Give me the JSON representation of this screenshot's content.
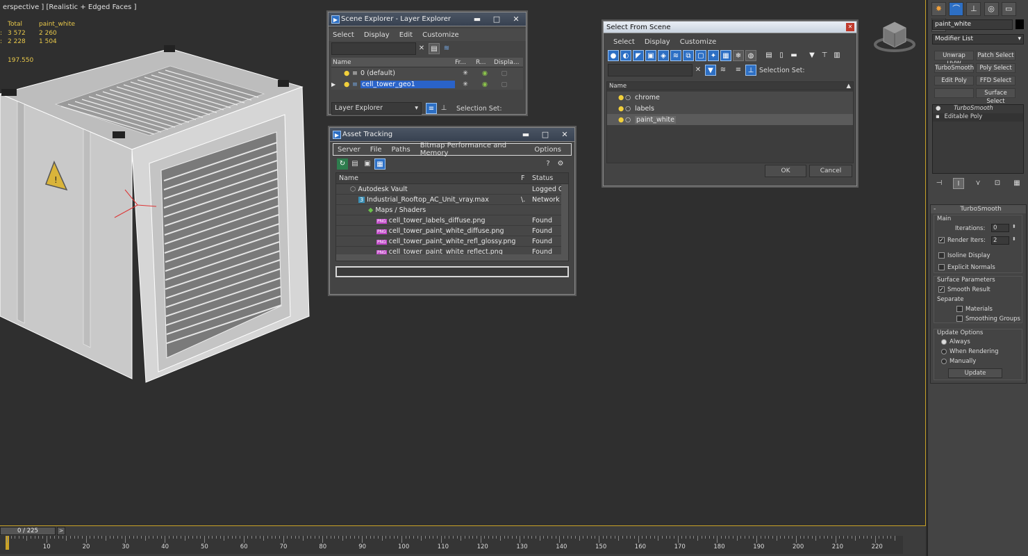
{
  "viewport": {
    "label": "erspective ] [Realistic + Edged Faces ]",
    "stats_header_total": "Total",
    "stats_header_sel": "paint_white",
    "row1_total": "3 572",
    "row1_sel": "2 260",
    "row2_total": "2 228",
    "row2_sel": "1 504",
    "fps": "197.550"
  },
  "layer_explorer": {
    "title": "Scene Explorer - Layer Explorer",
    "menu": [
      "Select",
      "Display",
      "Edit",
      "Customize"
    ],
    "columns": [
      "Name",
      "Fr...",
      "R...",
      "Displa..."
    ],
    "rows": [
      "0 (default)",
      "cell_tower_geo1"
    ],
    "footer_dropdown": "Layer Explorer",
    "selection_set": "Selection Set:"
  },
  "asset_tracking": {
    "title": "Asset Tracking",
    "menu": [
      "Server",
      "File",
      "Paths",
      "Bitmap Performance and Memory",
      "Options"
    ],
    "columns": [
      "Name",
      "F",
      "Status"
    ],
    "rows": [
      {
        "name": "Autodesk Vault",
        "f": "",
        "status": "Logged O"
      },
      {
        "name": "Industrial_Rooftop_AC_Unit_vray.max",
        "f": "\\.",
        "status": "Network"
      },
      {
        "name": "Maps / Shaders",
        "f": "",
        "status": ""
      },
      {
        "name": "cell_tower_labels_diffuse.png",
        "f": "",
        "status": "Found"
      },
      {
        "name": "cell_tower_paint_white_diffuse.png",
        "f": "",
        "status": "Found"
      },
      {
        "name": "cell_tower_paint_white_refl_glossy.png",
        "f": "",
        "status": "Found"
      },
      {
        "name": "cell_tower_paint_white_reflect.png",
        "f": "",
        "status": "Found"
      }
    ]
  },
  "select_from_scene": {
    "title": "Select From Scene",
    "menu": [
      "Select",
      "Display",
      "Customize"
    ],
    "selection_set": "Selection Set:",
    "column": "Name",
    "rows": [
      "chrome",
      "labels",
      "paint_white"
    ],
    "ok": "OK",
    "cancel": "Cancel"
  },
  "command_panel": {
    "object_name": "paint_white",
    "modifier_list": "Modifier List",
    "buttons": [
      "Unwrap UVW",
      "Patch Select",
      "TurboSmooth",
      "Poly Select",
      "Edit Poly",
      "FFD Select",
      "",
      "Surface Select"
    ],
    "stack": [
      "TurboSmooth",
      "Editable Poly"
    ],
    "rollout_title": "TurboSmooth",
    "main": "Main",
    "iterations_label": "Iterations:",
    "iterations_value": "0",
    "render_iters_label": "Render Iters:",
    "render_iters_value": "2",
    "isoline": "Isoline Display",
    "explicit_normals": "Explicit Normals",
    "surface_params": "Surface Parameters",
    "smooth_result": "Smooth Result",
    "separate": "Separate",
    "materials": "Materials",
    "smoothing_groups": "Smoothing Groups",
    "update_options": "Update Options",
    "always": "Always",
    "when_rendering": "When Rendering",
    "manually": "Manually",
    "update": "Update"
  },
  "timeline": {
    "frame": "0 / 225",
    "ticks": [
      "10",
      "20",
      "30",
      "40",
      "50",
      "60",
      "70",
      "80",
      "90",
      "100",
      "110",
      "120",
      "130",
      "140",
      "150",
      "160",
      "170",
      "180",
      "190",
      "200",
      "210",
      "220"
    ]
  }
}
